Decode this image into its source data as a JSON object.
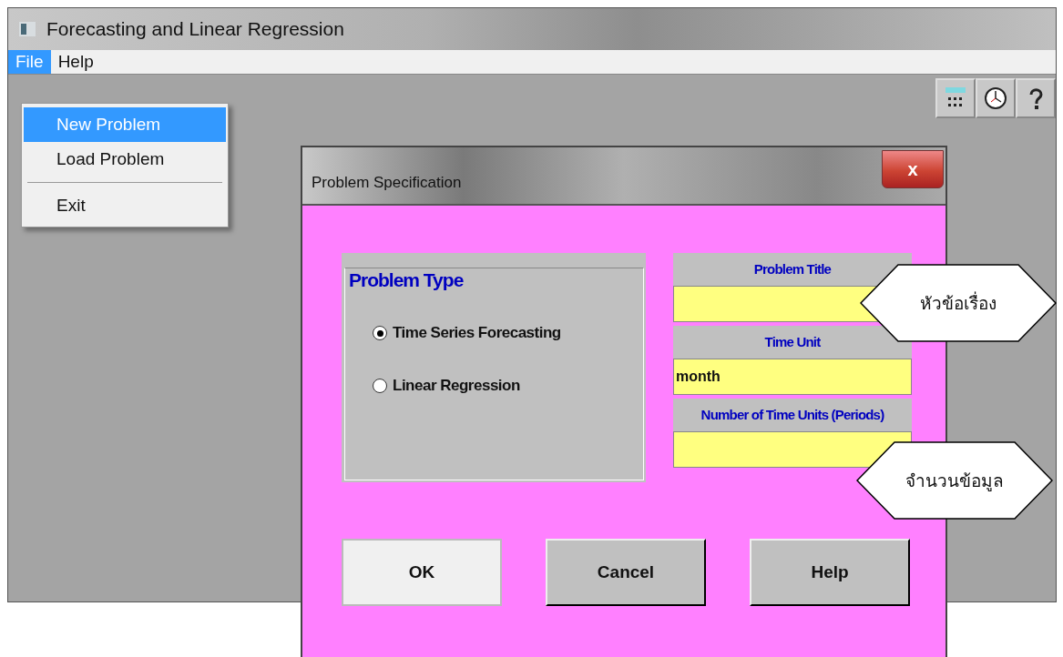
{
  "window": {
    "title": "Forecasting and Linear Regression"
  },
  "menu_bar": [
    {
      "label": "File",
      "selected": true
    },
    {
      "label": "Help",
      "selected": false
    }
  ],
  "file_menu": [
    {
      "kind": "item",
      "label": "New Problem",
      "selected": true
    },
    {
      "kind": "item",
      "label": "Load Problem",
      "selected": false
    },
    {
      "kind": "separator"
    },
    {
      "kind": "item",
      "label": "Exit",
      "selected": false
    }
  ],
  "dialog": {
    "title": "Problem Specification",
    "close": "x",
    "problem_type": {
      "legend": "Problem Type",
      "options": [
        {
          "label": "Time Series Forecasting",
          "selected": true
        },
        {
          "label": "Linear Regression",
          "selected": false
        }
      ]
    },
    "fields": [
      {
        "label": "Problem Title"
      },
      {
        "label": "Time Unit",
        "value": "month"
      },
      {
        "label": "Number of Time Units (Periods)"
      }
    ],
    "buttons": [
      {
        "label": "OK",
        "focused": true
      },
      {
        "label": "Cancel",
        "focused": false
      },
      {
        "label": "Help",
        "focused": false
      }
    ]
  },
  "callouts": [
    "หัวข้อเรื่อง",
    "จำนวนข้อมูล"
  ]
}
